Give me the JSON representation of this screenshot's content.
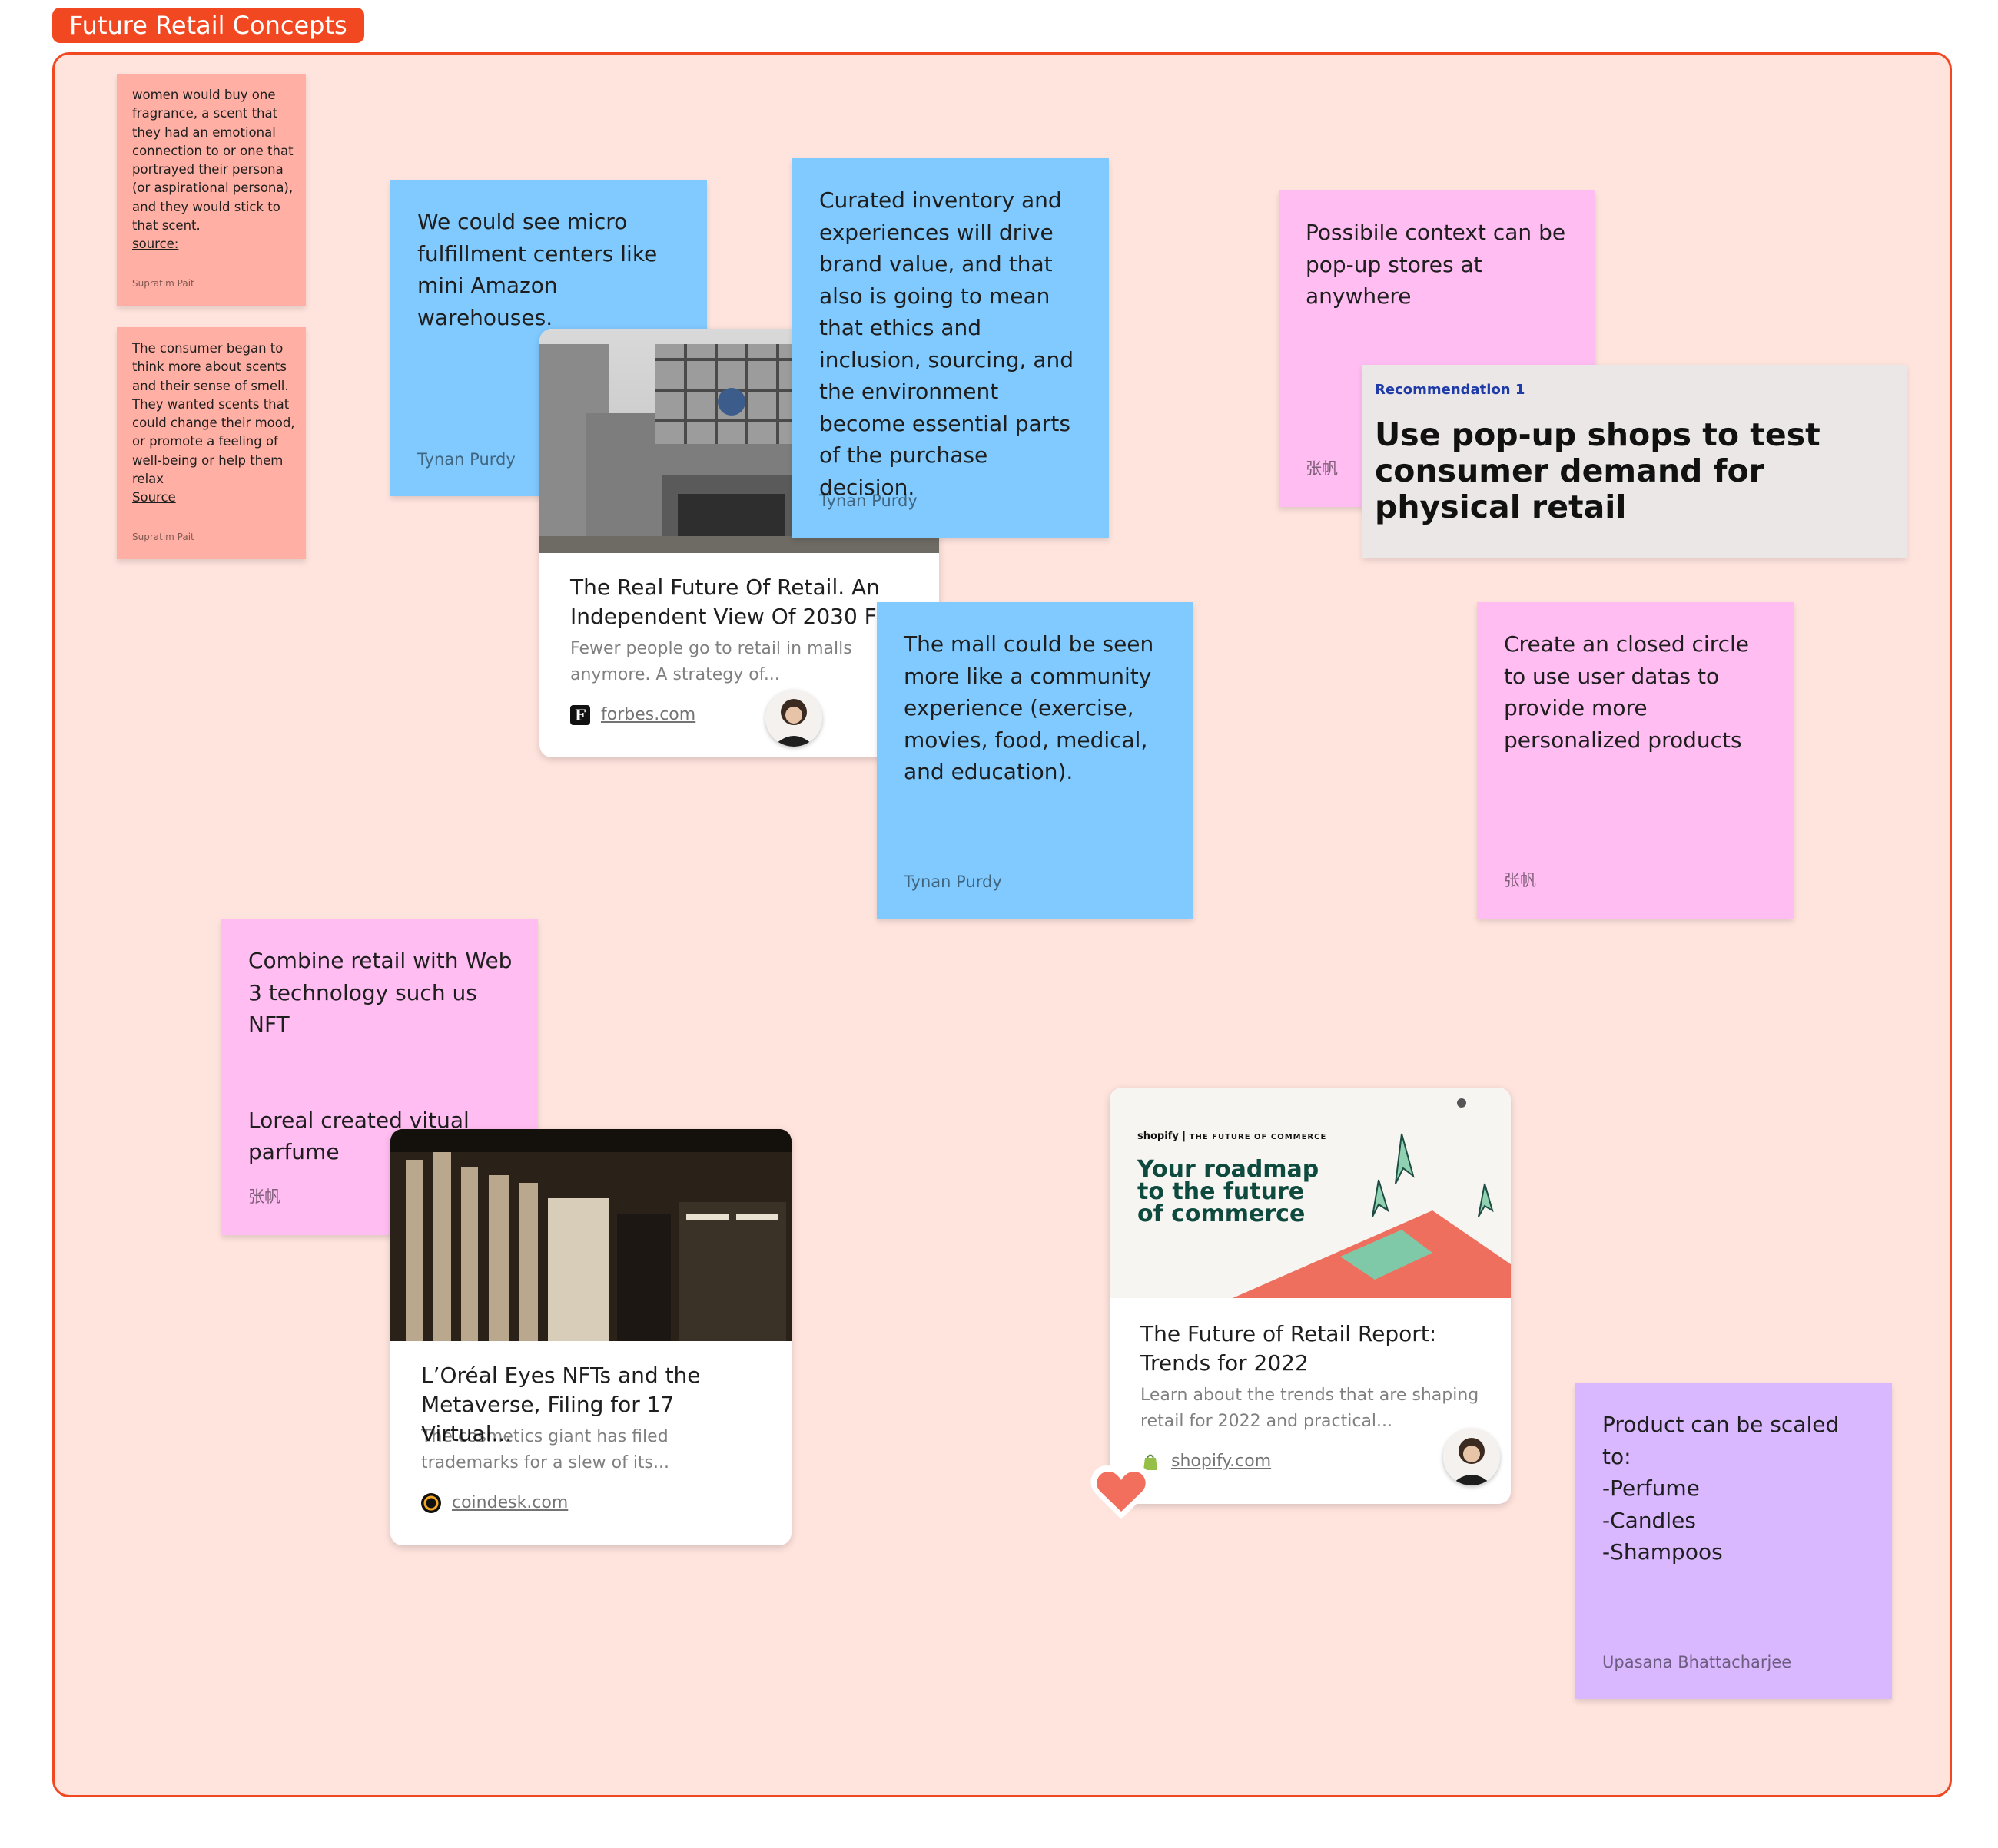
{
  "section": {
    "title": "Future Retail Concepts"
  },
  "stickies": {
    "scent1": {
      "text": "women would buy one fragrance, a scent that they had an emotional connection to or one that portrayed their persona (or aspirational persona), and they would stick to that scent.",
      "source": "source:",
      "author": "Supratim Pait"
    },
    "scent2": {
      "text": "The consumer began to think more about scents and their sense of smell. They wanted scents that could change their mood, or promote a feeling of well-being or help them relax",
      "source": "Source",
      "author": "Supratim Pait"
    },
    "micro": {
      "text": "We could see micro fulfillment centers like mini Amazon warehouses.",
      "author": "Tynan Purdy"
    },
    "curated": {
      "text": "Curated inventory and experiences will drive brand value, and that also is going to mean that ethics and inclusion, sourcing, and the environment become essential parts of the purchase decision.",
      "author": "Tynan Purdy"
    },
    "popup": {
      "text": "Possibile context can be pop-up stores at anywhere",
      "author": "张帆"
    },
    "mall": {
      "text": "The mall could be seen more like a community experience (exercise, movies, food, medical, and education).",
      "author": "Tynan Purdy"
    },
    "circle": {
      "text": "Create an closed circle to use user datas to provide more personalized products",
      "author": "张帆"
    },
    "web3": {
      "text": "Combine retail with Web 3 technology such us NFT\n\n\nLoreal created vitual parfume",
      "author": "张帆"
    },
    "scaled": {
      "text": "Product can be scaled to:\n-Perfume\n-Candles\n-Shampoos",
      "author": "Upasana Bhattacharjee"
    }
  },
  "recommendation": {
    "label": "Recommendation 1",
    "title": "Use pop-up shops to test consumer demand for physical retail"
  },
  "cards": {
    "forbes": {
      "title": "The Real Future Of Retail. An Independent View Of 2030 Fr...",
      "desc": "Fewer people go to retail in malls anymore. A strategy of...",
      "link": "forbes.com",
      "favicon": "F"
    },
    "loreal": {
      "title": "L’Oréal Eyes NFTs and the Metaverse, Filing for 17 Virtual...",
      "desc": "The cosmetics giant has filed trademarks for a slew of its...",
      "link": "coindesk.com"
    },
    "shopify": {
      "title": "The Future of Retail Report: Trends for 2022",
      "desc": "Learn about the trends that are shaping retail for 2022 and practical...",
      "link": "shopify.com",
      "banner_brand": "shopify",
      "banner_tag": "THE FUTURE OF COMMERCE",
      "banner_headline": "Your roadmap to the future of commerce"
    }
  },
  "colors": {
    "section_border": "#f24822",
    "section_fill": "#ffe3dd",
    "blue": "#80caff",
    "pink": "#ffbdf2",
    "salmon": "#ffafa3",
    "violet": "#d9b8ff"
  },
  "icons": [
    "heart-reaction-icon",
    "forbes-favicon",
    "coindesk-favicon",
    "shopify-favicon"
  ]
}
